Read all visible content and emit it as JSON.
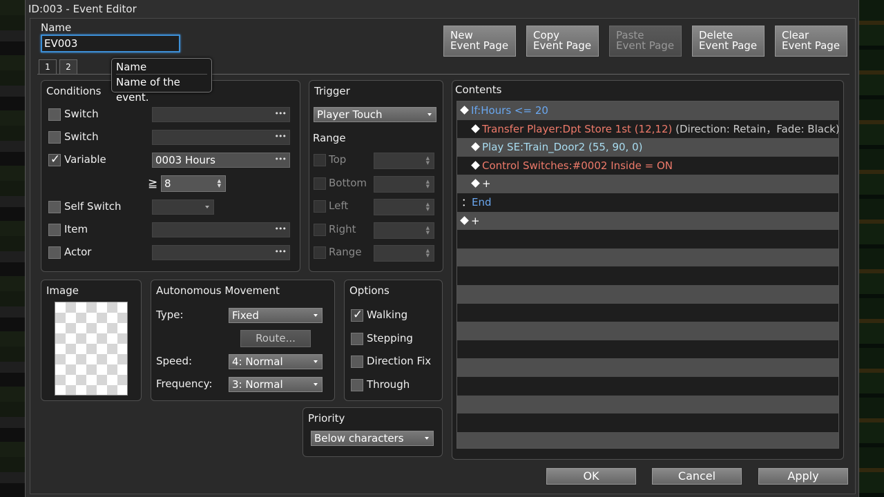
{
  "window": {
    "title": "ID:003 - Event Editor"
  },
  "name_field": {
    "label": "Name",
    "value": "EV003"
  },
  "tooltip": {
    "title": "Name",
    "description": "Name of the event."
  },
  "page_buttons": [
    {
      "line1": "New",
      "line2": "Event Page",
      "enabled": true
    },
    {
      "line1": "Copy",
      "line2": "Event Page",
      "enabled": true
    },
    {
      "line1": "Paste",
      "line2": "Event Page",
      "enabled": false
    },
    {
      "line1": "Delete",
      "line2": "Event Page",
      "enabled": true
    },
    {
      "line1": "Clear",
      "line2": "Event Page",
      "enabled": true
    }
  ],
  "tabs": [
    "1",
    "2"
  ],
  "conditions": {
    "title": "Conditions",
    "switch1": {
      "label": "Switch",
      "checked": false,
      "value": ""
    },
    "switch2": {
      "label": "Switch",
      "checked": false,
      "value": ""
    },
    "variable": {
      "label": "Variable",
      "checked": true,
      "value": "0003 Hours"
    },
    "variable_op": "≧",
    "variable_amount": "8",
    "self_switch": {
      "label": "Self Switch",
      "checked": false,
      "value": ""
    },
    "item": {
      "label": "Item",
      "checked": false,
      "value": ""
    },
    "actor": {
      "label": "Actor",
      "checked": false,
      "value": ""
    }
  },
  "trigger": {
    "title": "Trigger",
    "value": "Player Touch",
    "range_label": "Range",
    "range_items": [
      {
        "label": "Top"
      },
      {
        "label": "Bottom"
      },
      {
        "label": "Left"
      },
      {
        "label": "Right"
      },
      {
        "label": "Range"
      }
    ]
  },
  "image": {
    "title": "Image"
  },
  "movement": {
    "title": "Autonomous Movement",
    "type_label": "Type:",
    "type_value": "Fixed",
    "route_button": "Route...",
    "speed_label": "Speed:",
    "speed_value": "4: Normal",
    "frequency_label": "Frequency:",
    "frequency_value": "3: Normal"
  },
  "options": {
    "title": "Options",
    "walking": {
      "label": "Walking",
      "checked": true
    },
    "stepping": {
      "label": "Stepping",
      "checked": false
    },
    "direction_fix": {
      "label": "Direction Fix",
      "checked": false
    },
    "through": {
      "label": "Through",
      "checked": false
    }
  },
  "priority": {
    "title": "Priority",
    "value": "Below characters"
  },
  "contents": {
    "title": "Contents",
    "commands": [
      {
        "indent": 0,
        "diamond": true,
        "parts": [
          {
            "text": "If:Hours <= 20",
            "color": "blue"
          }
        ]
      },
      {
        "indent": 1,
        "diamond": true,
        "parts": [
          {
            "text": "Transfer Player:Dpt Store 1st (12,12)",
            "color": "red"
          },
          {
            "text": " (Direction: Retain，Fade: Black)",
            "color": "gray"
          }
        ]
      },
      {
        "indent": 1,
        "diamond": true,
        "parts": [
          {
            "text": "Play SE:Train_Door2 (55, 90, 0)",
            "color": "cyan"
          }
        ]
      },
      {
        "indent": 1,
        "diamond": true,
        "parts": [
          {
            "text": "Control Switches:#0002 Inside = ON",
            "color": "red"
          }
        ]
      },
      {
        "indent": 1,
        "diamond": true,
        "parts": [
          {
            "text": "+",
            "color": "white"
          }
        ]
      },
      {
        "indent": 0,
        "diamond": false,
        "parts": [
          {
            "text": "：",
            "color": "white"
          },
          {
            "text": "End",
            "color": "blue"
          }
        ]
      },
      {
        "indent": 0,
        "diamond": true,
        "parts": [
          {
            "text": "+",
            "color": "white"
          }
        ]
      }
    ]
  },
  "bottom_buttons": {
    "ok": "OK",
    "cancel": "Cancel",
    "apply": "Apply"
  }
}
